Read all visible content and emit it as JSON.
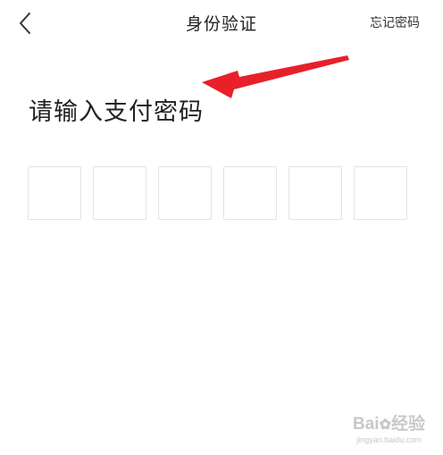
{
  "header": {
    "title": "身份验证",
    "forgot_label": "忘记密码"
  },
  "main": {
    "heading": "请输入支付密码",
    "pin_length": 6
  },
  "watermark": {
    "brand": "Bai",
    "brand_suffix": "经验",
    "domain": "jingyan.baidu.com"
  },
  "colors": {
    "annotation_arrow": "#e8202a",
    "box_border": "#e3e3e3",
    "text": "#222222"
  }
}
